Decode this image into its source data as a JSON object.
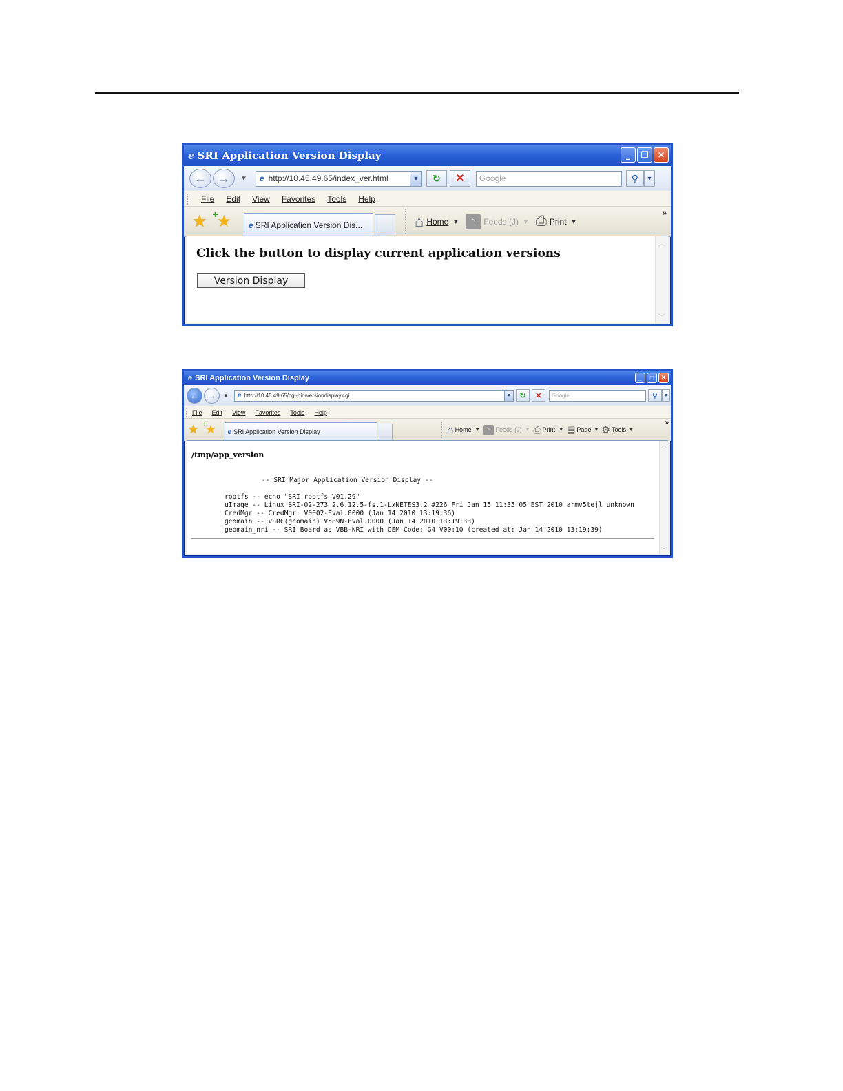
{
  "window1": {
    "title": "SRI Application Version Display",
    "url": "http://10.45.49.65/index_ver.html",
    "search_placeholder": "Google",
    "menu": [
      "File",
      "Edit",
      "View",
      "Favorites",
      "Tools",
      "Help"
    ],
    "tab_label": "SRI Application Version Dis...",
    "commands": {
      "home": "Home",
      "feeds": "Feeds (J)",
      "print": "Print"
    },
    "heading": "Click the button to display current application versions",
    "button_label": "Version Display"
  },
  "window2": {
    "title": "SRI Application Version Display",
    "url": "http://10.45.49.65/cgi-bin/versiondisplay.cgi",
    "search_placeholder": "Google",
    "menu": [
      "File",
      "Edit",
      "View",
      "Favorites",
      "Tools",
      "Help"
    ],
    "tab_label": "SRI Application Version Display",
    "commands": {
      "home": "Home",
      "feeds": "Feeds (J)",
      "print": "Print",
      "page": "Page",
      "tools": "Tools"
    },
    "path": "/tmp/app_version",
    "banner": "-- SRI Major Application Version Display --",
    "lines": [
      "rootfs -- echo \"SRI rootfs V01.29\"",
      "uImage -- Linux SRI-02-273 2.6.12.5-fs.1-LxNETES3.2 #226 Fri Jan 15 11:35:05 EST 2010 armv5tejl unknown",
      "CredMgr -- CredMgr: V0002-Eval.0000 (Jan 14 2010 13:19:36)",
      "geomain -- VSRC(geomain) V589N-Eval.0000 (Jan 14 2010 13:19:33)",
      "geomain_nri -- SRI Board as VBB-NRI with OEM Code: G4 V00:10 (created at: Jan 14 2010 13:19:39)"
    ]
  },
  "icons": {
    "ie": "ie-logo-icon",
    "back": "back-arrow-icon",
    "forward": "forward-arrow-icon",
    "refresh": "refresh-icon",
    "stop": "stop-icon",
    "search": "magnifier-icon",
    "favorites": "star-icon",
    "add_favorite": "add-favorite-icon",
    "home": "home-icon",
    "feeds": "rss-icon",
    "print": "printer-icon",
    "page": "page-icon",
    "tools": "gear-icon"
  },
  "colors": {
    "title_bar": "#2c62d8",
    "close_button": "#d4431f"
  }
}
